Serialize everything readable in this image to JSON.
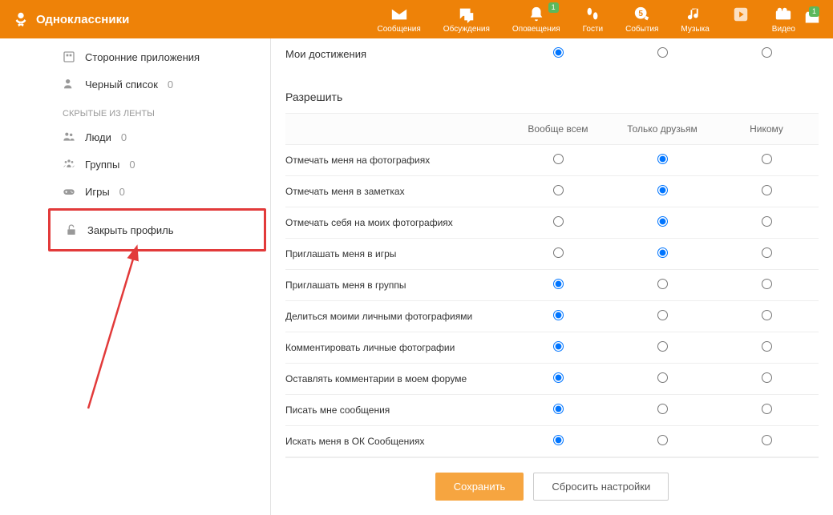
{
  "header": {
    "brand": "Одноклассники",
    "nav": [
      {
        "label": "Сообщения",
        "badge": null
      },
      {
        "label": "Обсуждения",
        "badge": null
      },
      {
        "label": "Оповещения",
        "badge": "1"
      },
      {
        "label": "Гости",
        "badge": null
      },
      {
        "label": "События",
        "badge": null
      },
      {
        "label": "Музыка",
        "badge": null
      },
      {
        "label": "",
        "badge": null
      },
      {
        "label": "Видео",
        "badge": null
      }
    ],
    "wallet_badge": "1"
  },
  "sidebar": {
    "items_top": [
      {
        "label": "Сторонние приложения",
        "count": ""
      },
      {
        "label": "Черный список",
        "count": "0"
      }
    ],
    "section": "СКРЫТЫЕ ИЗ ЛЕНТЫ",
    "hidden_items": [
      {
        "label": "Люди",
        "count": "0"
      },
      {
        "label": "Группы",
        "count": "0"
      },
      {
        "label": "Игры",
        "count": "0"
      }
    ],
    "close_profile": "Закрыть профиль"
  },
  "settings": {
    "top_row": {
      "label": "Мои достижения",
      "selected": 0
    },
    "section_title": "Разрешить",
    "columns": [
      "Вообще всем",
      "Только друзьям",
      "Никому"
    ],
    "rows": [
      {
        "label": "Отмечать меня на фотографиях",
        "selected": 1
      },
      {
        "label": "Отмечать меня в заметках",
        "selected": 1
      },
      {
        "label": "Отмечать себя на моих фотографиях",
        "selected": 1
      },
      {
        "label": "Приглашать меня в игры",
        "selected": 1
      },
      {
        "label": "Приглашать меня в группы",
        "selected": 0
      },
      {
        "label": "Делиться моими личными фотографиями",
        "selected": 0
      },
      {
        "label": "Комментировать личные фотографии",
        "selected": 0
      },
      {
        "label": "Оставлять комментарии в моем форуме",
        "selected": 0
      },
      {
        "label": "Писать мне сообщения",
        "selected": 0
      },
      {
        "label": "Искать меня в ОК Сообщениях",
        "selected": 0
      }
    ]
  },
  "footer": {
    "save": "Сохранить",
    "reset": "Сбросить настройки"
  }
}
